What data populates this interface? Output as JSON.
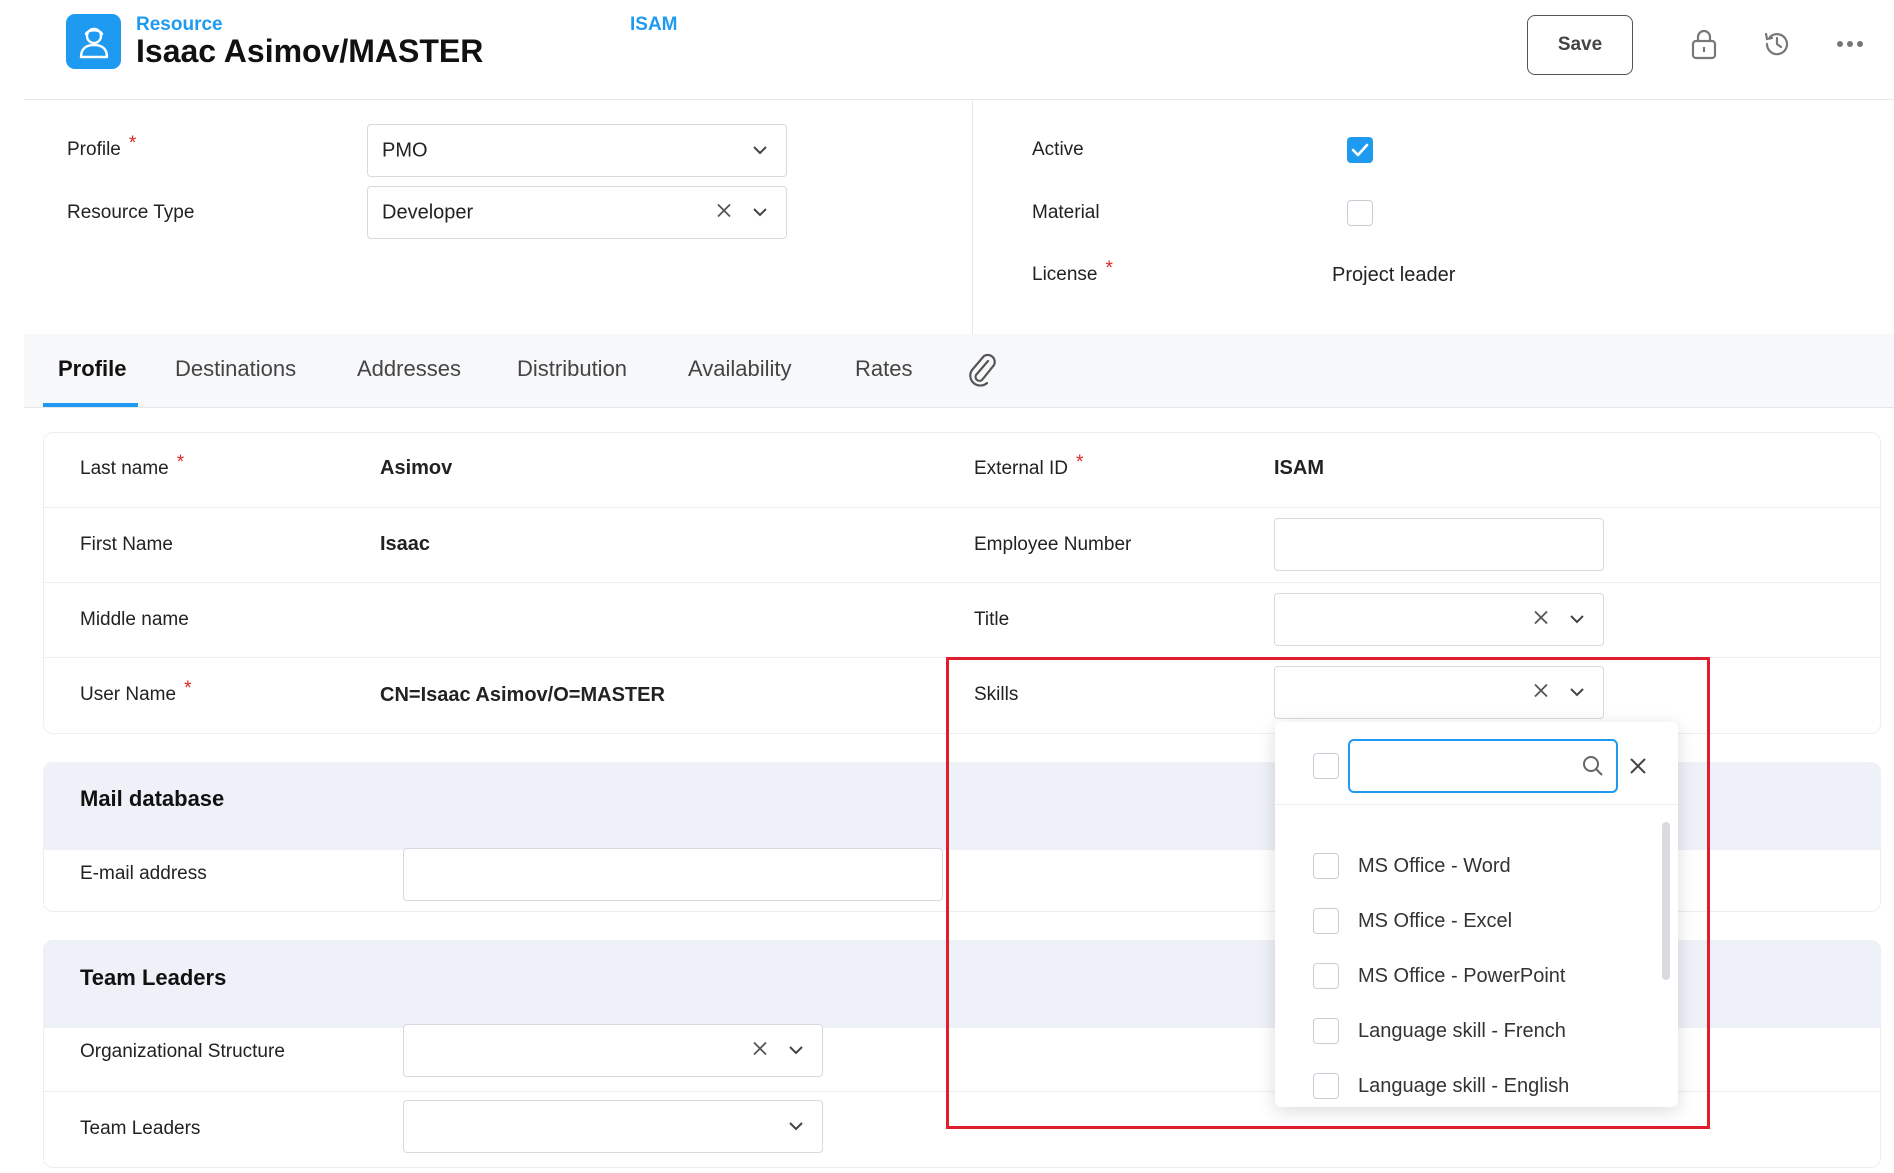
{
  "header": {
    "record_type": "Resource",
    "title": "Isaac Asimov/MASTER",
    "code": "ISAM",
    "save_label": "Save"
  },
  "top_form": {
    "profile_label": "Profile",
    "profile_value": "PMO",
    "resource_type_label": "Resource Type",
    "resource_type_value": "Developer",
    "active_label": "Active",
    "active_checked": true,
    "material_label": "Material",
    "material_checked": false,
    "license_label": "License",
    "license_value": "Project leader",
    "required_mark": "*"
  },
  "tabs": [
    {
      "label": "Profile",
      "active": true
    },
    {
      "label": "Destinations"
    },
    {
      "label": "Addresses"
    },
    {
      "label": "Distribution"
    },
    {
      "label": "Availability"
    },
    {
      "label": "Rates"
    }
  ],
  "profile": {
    "last_name_label": "Last name",
    "last_name_value": "Asimov",
    "first_name_label": "First Name",
    "first_name_value": "Isaac",
    "middle_name_label": "Middle name",
    "user_name_label": "User Name",
    "user_name_value": "CN=Isaac Asimov/O=MASTER",
    "external_id_label": "External ID",
    "external_id_value": "ISAM",
    "employee_number_label": "Employee Number",
    "title_label": "Title",
    "skills_label": "Skills"
  },
  "mail_section": {
    "title": "Mail database",
    "email_label": "E-mail address"
  },
  "team_section": {
    "title": "Team Leaders",
    "org_structure_label": "Organizational Structure",
    "team_leaders_label": "Team Leaders"
  },
  "skills_dropdown": {
    "search_value": "",
    "options": [
      "MS Office - Word",
      "MS Office - Excel",
      "MS Office - PowerPoint",
      "Language skill - French",
      "Language skill - English"
    ]
  },
  "colors": {
    "accent": "#1e9bf0",
    "required": "#e02424",
    "highlight_box": "#e01e2e"
  }
}
